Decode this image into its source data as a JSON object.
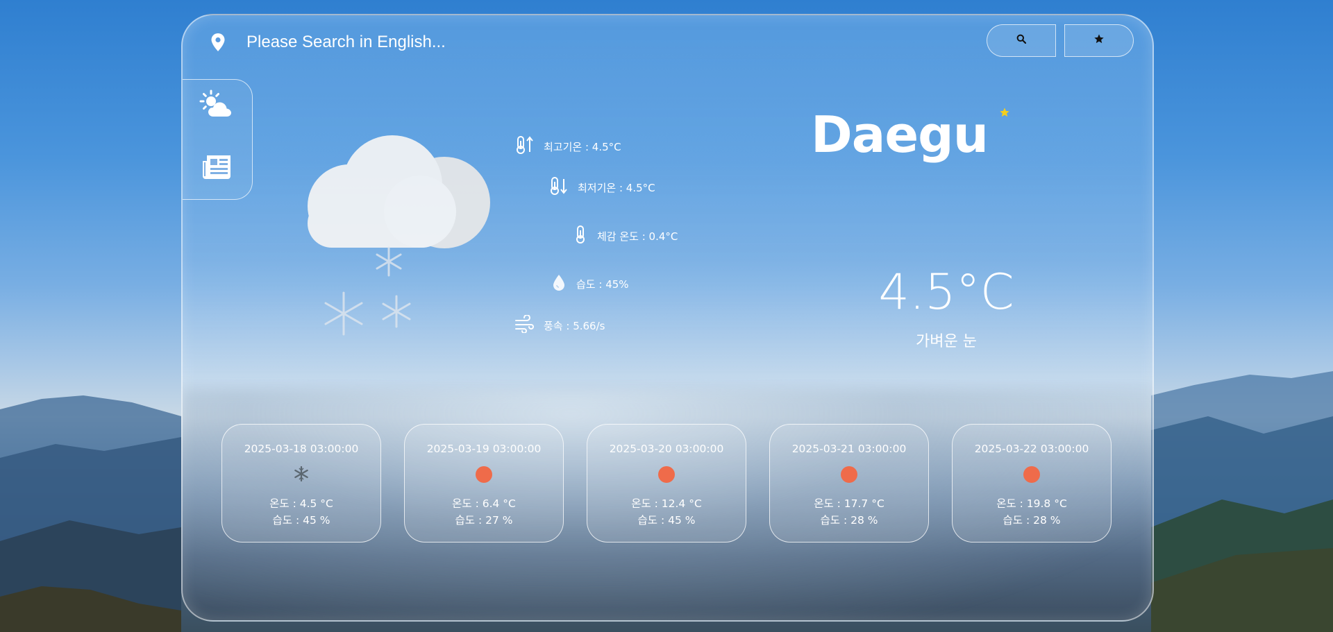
{
  "search": {
    "placeholder": "Please Search in English..."
  },
  "icons": {
    "location": "map-pin-icon",
    "search": "search-icon",
    "favorite": "star-icon",
    "nav_weather": "sun-cloud-icon",
    "nav_news": "newspaper-icon",
    "current_weather": "cloud-snow-icon"
  },
  "city": {
    "name": "Daegu",
    "favorite_star_color": "#f5cf1b"
  },
  "current": {
    "temperature": "4.5°C",
    "description": "가벼운 눈"
  },
  "details": {
    "max_temp": "최고기온 : 4.5°C",
    "min_temp": "최저기온 : 4.5°C",
    "feels_like": "체감 온도 : 0.4°C",
    "humidity": "습도 : 45%",
    "wind": "풍속 : 5.66/s"
  },
  "forecast": [
    {
      "date": "2025-03-18 03:00:00",
      "icon": "snowflake-icon",
      "temp": "온도 : 4.5 °C",
      "humidity": "습도 : 45 %"
    },
    {
      "date": "2025-03-19 03:00:00",
      "icon": "sun-icon",
      "temp": "온도 : 6.4 °C",
      "humidity": "습도 : 27 %"
    },
    {
      "date": "2025-03-20 03:00:00",
      "icon": "sun-icon",
      "temp": "온도 : 12.4 °C",
      "humidity": "습도 : 45 %"
    },
    {
      "date": "2025-03-21 03:00:00",
      "icon": "sun-icon",
      "temp": "온도 : 17.7 °C",
      "humidity": "습도 : 28 %"
    },
    {
      "date": "2025-03-22 03:00:00",
      "icon": "sun-icon",
      "temp": "온도 : 19.8 °C",
      "humidity": "습도 : 28 %"
    }
  ],
  "colors": {
    "sun": "#ef6b4a",
    "text": "#ffffff"
  }
}
